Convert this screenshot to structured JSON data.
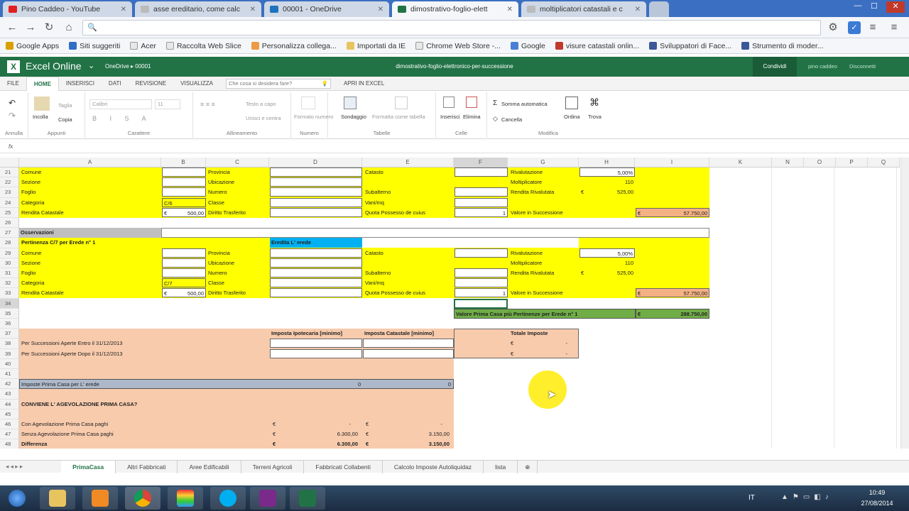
{
  "browser": {
    "tabs": [
      {
        "label": "Pino Caddeo - YouTube",
        "color": "#e02020"
      },
      {
        "label": "asse ereditario, come calc",
        "color": "#bbbbbb"
      },
      {
        "label": "00001 - OneDrive",
        "color": "#1e73be"
      },
      {
        "label": "dimostrativo-foglio-elett",
        "color": "#217346"
      },
      {
        "label": "moltiplicatori catastali e c",
        "color": "#bbbbbb"
      }
    ],
    "nav_icons": [
      "back-icon",
      "forward-icon",
      "reload-icon",
      "home-icon",
      "search-icon"
    ],
    "bookmarks": [
      "Google Apps",
      "Siti suggeriti",
      "Acer",
      "Raccolta Web Slice",
      "Personalizza collega...",
      "Importati da IE",
      "Chrome Web Store -...",
      "Google",
      "visure catastali onlin...",
      "Sviluppatori di Face...",
      "Strumento di moder..."
    ]
  },
  "excel": {
    "app": "Excel Online",
    "breadcrumb": "OneDrive ▸ 00001",
    "doc_title": "dimostrativo-foglio-elettronico-per-successione",
    "share": "Condividi",
    "user": "pino caddeo",
    "logout": "Disconnetti",
    "ribbon_tabs": [
      "FILE",
      "HOME",
      "INSERISCI",
      "DATI",
      "REVISIONE",
      "VISUALIZZA"
    ],
    "tell_me": "Che cosa si desidera fare?",
    "open_excel": "APRI IN EXCEL",
    "ribbon": {
      "annulla": "Annulla",
      "incolla": "Incolla",
      "taglia": "Taglia",
      "copia": "Copia",
      "appunti": "Appunti",
      "font": "Calibri",
      "size": "11",
      "carattere": "Carattere",
      "testo_capo": "Testo a capo",
      "unisci": "Unisci e centra",
      "allineamento": "Allineamento",
      "formato": "Formato numero",
      "numero": "Numero",
      "sondaggio": "Sondaggio",
      "formatta_tab": "Formatta come tabella",
      "tabelle": "Tabelle",
      "inserisci": "Inserisci",
      "elimina": "Elimina",
      "celle": "Celle",
      "somma": "Somma automatica",
      "cancella": "Cancella",
      "ordina": "Ordina",
      "trova": "Trova",
      "modifica": "Modifica"
    },
    "fx": "fx"
  },
  "columns": [
    "A",
    "B",
    "C",
    "D",
    "E",
    "F",
    "G",
    "H",
    "I",
    "K",
    "N",
    "O",
    "P",
    "Q"
  ],
  "rows": [
    "21",
    "22",
    "23",
    "24",
    "25",
    "26",
    "27",
    "28",
    "29",
    "30",
    "31",
    "32",
    "33",
    "34",
    "35",
    "36",
    "37",
    "38",
    "39",
    "40",
    "41",
    "42",
    "43",
    "44",
    "45",
    "46",
    "47",
    "48"
  ],
  "block1": {
    "comune": "Comune",
    "sezione": "Sezione",
    "foglio": "Foglio",
    "categoria": "Categoria",
    "cat_val": "C/6",
    "rendita": "Rendita Catastale",
    "euro": "€",
    "rendita_val": "500,00",
    "provincia": "Provincia",
    "ubicazione": "Ubicazione",
    "numero": "Numero",
    "classe": "Classe",
    "diritto": "Diritto Trasferito",
    "catasto": "Catasto",
    "subalterno": "Subalterno",
    "vani": "Vani/mq",
    "quota": "Quota Possesso de cuius",
    "quota_val": "1",
    "rivalutazione": "Rivalutazione",
    "riv_val": "5,00%",
    "molt": "Moltiplicatore",
    "molt_val": "110",
    "rend_riv": "Rendita Rivalutata",
    "rend_riv_val": "525,00",
    "valore": "Valore in Successione",
    "valore_val": "57.750,00"
  },
  "osservazioni": "Osservazioni",
  "pertinenza": "Pertinenza C/7 per Erede n° 1",
  "eredita": "Eredita L' erede",
  "block2": {
    "cat_val": "C/7",
    "rendita_val": "500,00",
    "valore_val": "57.750,00"
  },
  "totale_label": "Valore Prima Casa più Pertinenze per Erede n° 1",
  "totale_val": "288.750,00",
  "imposte": {
    "h1": "Imposta Ipotecaria [minimo]",
    "h2": "Imposta Catastale [minimo]",
    "h3": "Totale Imposte",
    "r1": "Per Successioni Aperte Entro il 31/12/2013",
    "r2": "Per Successioni Aperte Dopo il 31/12/2013",
    "dash": "-"
  },
  "prima_casa": {
    "label": "Imposte Prima Casa per L' erede",
    "v1": "0",
    "v2": "0"
  },
  "conviene": "CONVIENE L' AGEVOLAZIONE PRIMA CASA?",
  "confronto": {
    "con": "Con Agevolazione Prima Casa paghi",
    "senza": "Senza Agevolazione Prima Casa paghi",
    "diff": "Differenza",
    "v1": "6.300,00",
    "v2": "3.150,00"
  },
  "sheets": [
    "PrimaCasa",
    "Altri Fabbricati",
    "Aree Edificabili",
    "Terreni Agricoli",
    "Fabbricati Collabenti",
    "Calcolo Imposte Autoliquidaz",
    "lista"
  ],
  "taskbar": {
    "lang": "IT",
    "time": "10:49",
    "date": "27/08/2014"
  }
}
